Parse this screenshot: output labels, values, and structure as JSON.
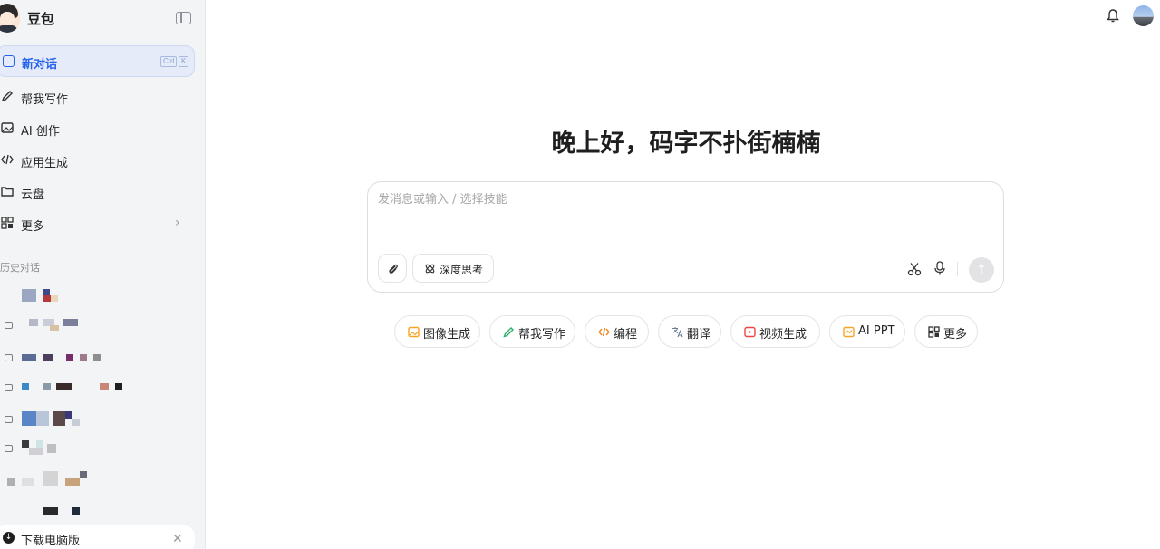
{
  "app": {
    "name": "豆包"
  },
  "sidebar": {
    "new_chat": {
      "label": "新对话",
      "shortcut_keys": [
        "Ctrl",
        "K"
      ]
    },
    "items": [
      {
        "label": "帮我写作",
        "icon": "pen-icon"
      },
      {
        "label": "AI 创作",
        "icon": "image-icon"
      },
      {
        "label": "应用生成",
        "icon": "code-icon"
      },
      {
        "label": "云盘",
        "icon": "folder-icon"
      },
      {
        "label": "更多",
        "icon": "grid-icon"
      }
    ],
    "history_title": "历史对话",
    "download": {
      "label": "下载电脑版"
    }
  },
  "main": {
    "greeting": "晚上好，码字不扑街楠楠",
    "composer": {
      "placeholder": "发消息或输入 / 选择技能",
      "deep_think_label": "深度思考"
    },
    "skills": [
      {
        "label": "图像生成",
        "color": "#f5a623"
      },
      {
        "label": "帮我写作",
        "color": "#2fb36b"
      },
      {
        "label": "编程",
        "color": "#f08a24"
      },
      {
        "label": "翻译",
        "color": "#6b7c93"
      },
      {
        "label": "视频生成",
        "color": "#ef4444"
      },
      {
        "label": "AI PPT",
        "color": "#f5a623"
      },
      {
        "label": "更多",
        "color": "#333333"
      }
    ]
  },
  "colors": {
    "accent": "#2563eb",
    "sidebar_bg": "#f3f4f6"
  }
}
